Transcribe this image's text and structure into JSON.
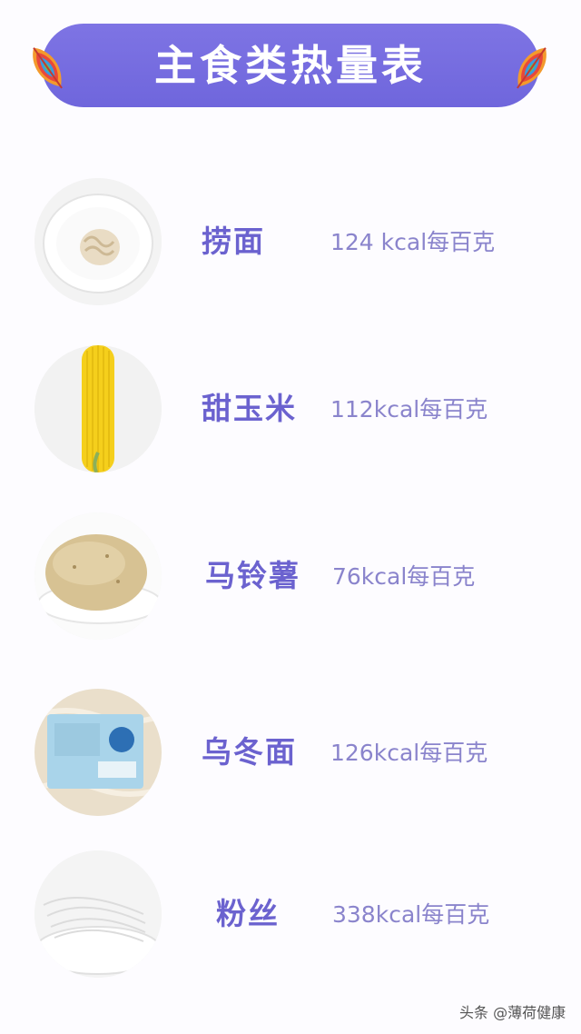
{
  "header": {
    "title": "主食类热量表",
    "accent_color": "#6f66dc",
    "decoration_icon": "striped-leaf-icon"
  },
  "items": [
    {
      "name": "捞面",
      "kcal": "124 kcal每百克",
      "image": "noodle-bowl"
    },
    {
      "name": "甜玉米",
      "kcal": "112kcal每百克",
      "image": "sweet-corn"
    },
    {
      "name": "马铃薯",
      "kcal": "76kcal每百克",
      "image": "potato"
    },
    {
      "name": "乌冬面",
      "kcal": "126kcal每百克",
      "image": "udon-package"
    },
    {
      "name": "粉丝",
      "kcal": "338kcal每百克",
      "image": "vermicelli"
    }
  ],
  "watermark": "头条 @薄荷健康"
}
